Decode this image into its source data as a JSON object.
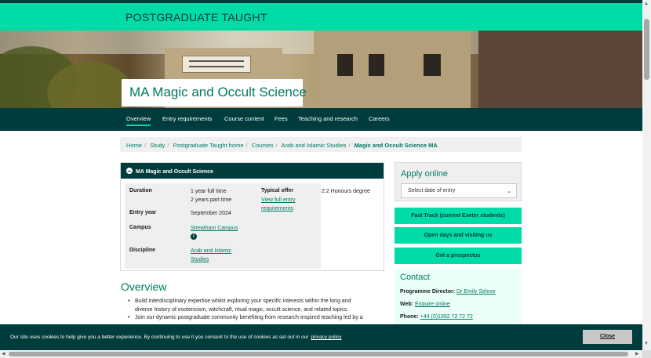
{
  "colors": {
    "brand_dark": "#003c3c",
    "brand_green": "#00dca5",
    "link": "#007a63"
  },
  "header": {
    "section_title": "POSTGRADUATE TAUGHT"
  },
  "hero": {
    "course_title": "MA Magic and Occult Science"
  },
  "tabs": [
    {
      "label": "Overview",
      "active": true
    },
    {
      "label": "Entry requirements"
    },
    {
      "label": "Course content"
    },
    {
      "label": "Fees"
    },
    {
      "label": "Teaching and research"
    },
    {
      "label": "Careers"
    }
  ],
  "breadcrumb": [
    "Home",
    "Study",
    "Postgraduate Taught home",
    "Courses",
    "Arab and Islamic Studies",
    "Magic and Occult Science MA"
  ],
  "info": {
    "header": "MA Magic and Occult Science",
    "duration_label": "Duration",
    "duration_values": [
      "1 year full time",
      "2 years part time"
    ],
    "entry_year_label": "Entry year",
    "entry_year_value": "September 2024",
    "campus_label": "Campus",
    "campus_value": "Streatham Campus",
    "discipline_label": "Discipline",
    "discipline_value": [
      "Arab and Islamic",
      "Studies"
    ],
    "offer_label": "Typical offer",
    "offer_link": [
      "View full entry",
      "requirements"
    ],
    "offer_value": "2:2 Honours degree",
    "campus_icon": "location-info-icon"
  },
  "overview": {
    "heading": "Overview",
    "bullets": [
      [
        "Build interdisciplinary expertise whilst exploring your specific interests within the long and",
        "diverse history of esotericism, witchcraft, ritual magic, occult science, and related topics."
      ],
      [
        "Join our dynamic postgraduate community benefiting from research-inspired teaching led by a"
      ]
    ]
  },
  "apply": {
    "title": "Apply online",
    "select_placeholder": "Select date of entry",
    "buttons": [
      "Fast Track (current Exeter students)",
      "Open days and visiting us",
      "Get a prospectus"
    ]
  },
  "contact": {
    "title": "Contact",
    "director_label": "Programme Director:",
    "director_name": "Dr Emily Selove",
    "web_label": "Web:",
    "web_link": "Enquire online",
    "phone_label": "Phone:",
    "phone_number": "+44 (0)1392 72 72 72"
  },
  "cookie": {
    "message": "Our site uses cookies to help give you a better experience. By continuing to use it you consent to the use of cookies as set out in our",
    "policy_link": "privacy policy",
    "close_label": "Close"
  }
}
